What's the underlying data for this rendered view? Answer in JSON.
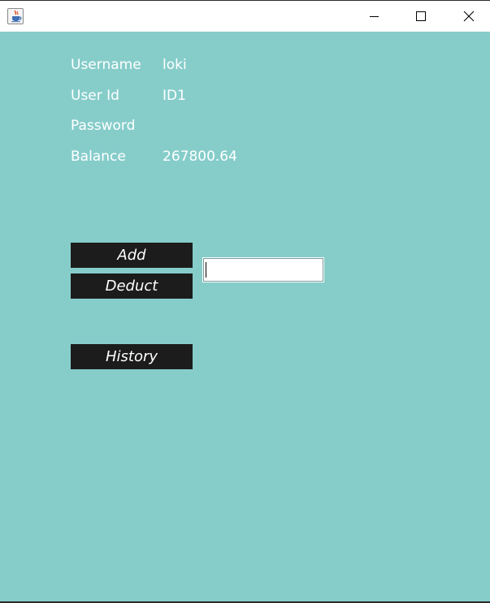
{
  "window": {
    "icon": "java-coffee-cup-icon",
    "controls": {
      "minimize": "minimize-icon",
      "maximize": "maximize-icon",
      "close": "close-icon"
    }
  },
  "colors": {
    "background": "#86cdca",
    "button_bg": "#1c1c1c",
    "text": "#ffffff"
  },
  "account": {
    "username_label": "Username",
    "username_value": "loki",
    "userid_label": "User Id",
    "userid_value": "ID1",
    "password_label": "Password",
    "password_value": "",
    "balance_label": "Balance",
    "balance_value": "267800.64"
  },
  "actions": {
    "add_label": "Add",
    "deduct_label": "Deduct",
    "history_label": "History",
    "amount_value": ""
  }
}
